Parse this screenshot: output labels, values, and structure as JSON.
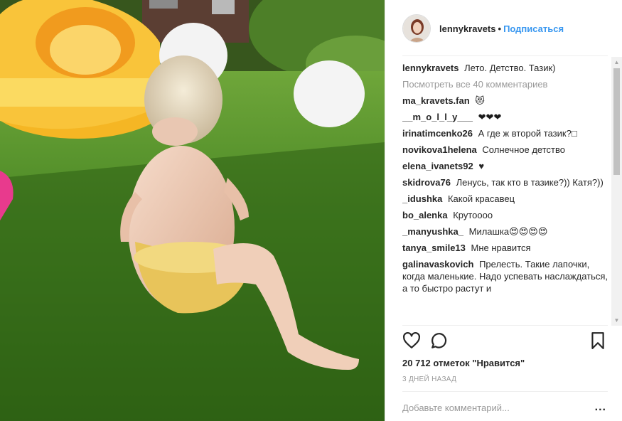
{
  "post": {
    "username": "lennykravets",
    "separator": "•",
    "follow_label": "Подписаться",
    "caption": "Лето. Детство. Тазик)",
    "view_all": "Посмотреть все 40 комментариев",
    "likes": "20 712 отметок \"Нравится\"",
    "time": "3 ДНЕЙ НАЗАД",
    "add_comment_placeholder": "Добавьте комментарий...",
    "more_options": "..."
  },
  "comments": [
    {
      "user": "ma_kravets.fan",
      "text": "😻"
    },
    {
      "user": "__m_o_l_l_y___",
      "text": "❤❤❤"
    },
    {
      "user": "irinatimcenko26",
      "text": "А где ж второй тазик?□"
    },
    {
      "user": "novikova1helena",
      "text": "Солнечное детство"
    },
    {
      "user": "elena_ivanets92",
      "text": "♥"
    },
    {
      "user": "skidrova76",
      "text": "Ленусь, так кто в тазике?)) Катя?))"
    },
    {
      "user": "_idushka",
      "text": "Какой красавец"
    },
    {
      "user": "bo_alenka",
      "text": "Крутоооо"
    },
    {
      "user": "_manyushka_",
      "text": "Милашка😍😍😍😍"
    },
    {
      "user": "tanya_smile13",
      "text": "Мне нравится"
    },
    {
      "user": "galinavaskovich",
      "text": "Прелесть. Такие лапочки, когда маленькие. Надо успевать наслаждаться, а то быстро растут и"
    }
  ],
  "icons": {
    "heart": "heart-icon",
    "comment": "comment-icon",
    "bookmark": "bookmark-icon"
  },
  "colors": {
    "accent": "#3897f0",
    "muted": "#999999",
    "text": "#262626"
  }
}
